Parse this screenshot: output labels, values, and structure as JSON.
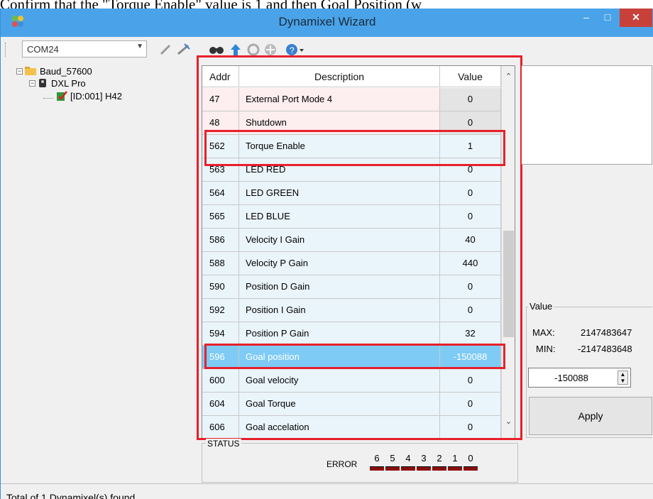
{
  "caption": "Confirm that the \"Torque Enable\" value is 1 and then Goal Position (w",
  "window": {
    "title": "Dynamixel Wizard",
    "min": "–",
    "max": "□",
    "close": "✕"
  },
  "toolbar": {
    "port": "COM24"
  },
  "tree": {
    "root": "Baud_57600",
    "model": "DXL Pro",
    "device": "[ID:001] H42"
  },
  "table": {
    "headers": {
      "addr": "Addr",
      "desc": "Description",
      "value": "Value"
    },
    "rows": [
      {
        "addr": "47",
        "desc": "External Port Mode 4",
        "value": "0"
      },
      {
        "addr": "48",
        "desc": "Shutdown",
        "value": "0"
      },
      {
        "addr": "562",
        "desc": "Torque Enable",
        "value": "1"
      },
      {
        "addr": "563",
        "desc": "LED RED",
        "value": "0"
      },
      {
        "addr": "564",
        "desc": "LED GREEN",
        "value": "0"
      },
      {
        "addr": "565",
        "desc": "LED BLUE",
        "value": "0"
      },
      {
        "addr": "586",
        "desc": "Velocity I Gain",
        "value": "40"
      },
      {
        "addr": "588",
        "desc": "Velocity P Gain",
        "value": "440"
      },
      {
        "addr": "590",
        "desc": "Position D Gain",
        "value": "0"
      },
      {
        "addr": "592",
        "desc": "Position I Gain",
        "value": "0"
      },
      {
        "addr": "594",
        "desc": "Position P Gain",
        "value": "32"
      },
      {
        "addr": "596",
        "desc": "Goal position",
        "value": "-150088"
      },
      {
        "addr": "600",
        "desc": "Goal velocity",
        "value": "0"
      },
      {
        "addr": "604",
        "desc": "Goal Torque",
        "value": "0"
      },
      {
        "addr": "606",
        "desc": "Goal accelation",
        "value": "0"
      }
    ]
  },
  "status": {
    "label": "STATUS",
    "error_label": "ERROR",
    "bits": [
      "6",
      "5",
      "4",
      "3",
      "2",
      "1",
      "0"
    ]
  },
  "value_panel": {
    "label": "Value",
    "max_label": "MAX:",
    "max": "2147483647",
    "min_label": "MIN:",
    "min": "-2147483648",
    "input": "-150088",
    "apply": "Apply"
  },
  "statusbar": {
    "text": "Total of 1 Dynamixel(s) found."
  },
  "colors": {
    "row_pink": "#fdeef0",
    "row_blue": "#eaf5fb",
    "row_selected": "#7ecbf5",
    "value_gray": "#e4e4e4",
    "highlight": "#e8202a"
  }
}
